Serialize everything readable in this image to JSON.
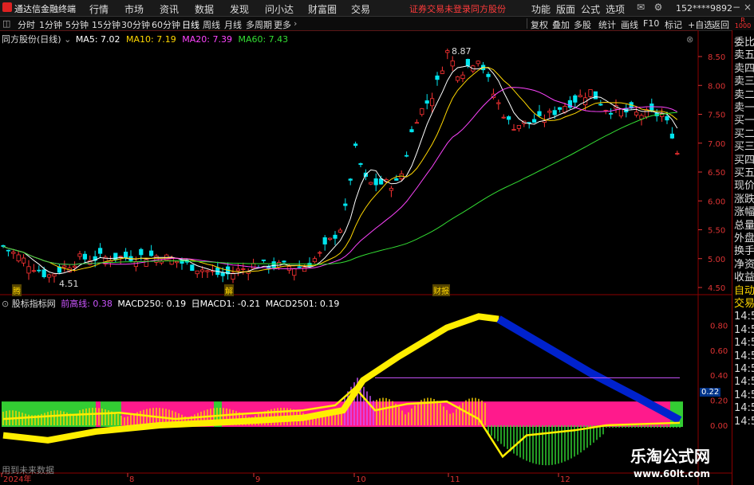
{
  "menu": {
    "app_title": "通达信金融终端",
    "items": [
      "行情",
      "市场",
      "资讯",
      "数据",
      "发现",
      "问小达",
      "财富圈",
      "交易"
    ],
    "login_status": "证券交易未登录",
    "stock_name": "同方股份",
    "right_items": [
      "功能",
      "版面",
      "公式",
      "选项"
    ],
    "account": "152****9892"
  },
  "period_bar": {
    "periods": [
      "分时",
      "1分钟",
      "5分钟",
      "15分钟",
      "30分钟",
      "60分钟",
      "日线",
      "周线",
      "月线",
      "多周期",
      "更多"
    ],
    "active": "日线",
    "tools": [
      "复权",
      "叠加",
      "多股",
      "统计",
      "画线",
      "F10",
      "标记",
      "+自选",
      "返回"
    ]
  },
  "price_panel": {
    "title": "同方股份(日线)",
    "ma": [
      {
        "label": "MA5: 7.02",
        "color": "#ffffff"
      },
      {
        "label": "MA10: 7.19",
        "color": "#ffd700"
      },
      {
        "label": "MA20: 7.39",
        "color": "#ff44ff"
      },
      {
        "label": "MA60: 7.43",
        "color": "#33dd33"
      }
    ],
    "high_label": "8.87",
    "low_label": "4.51",
    "y_ticks": [
      "8.50",
      "8.00",
      "7.50",
      "7.00",
      "6.50",
      "6.00",
      "5.50",
      "5.00",
      "4.50"
    ],
    "markers": [
      {
        "text": "腾"
      },
      {
        "text": "解"
      },
      {
        "text": "财报"
      }
    ]
  },
  "indicator_panel": {
    "title": "股标指标网",
    "values": [
      {
        "label": "前高线: 0.38",
        "color": "#cc55ff"
      },
      {
        "label": "MACD250: 0.19",
        "color": "#ffffff"
      },
      {
        "label": "日MACD1: -0.21",
        "color": "#ffffff"
      },
      {
        "label": "MACD2501: 0.19",
        "color": "#ffffff"
      }
    ],
    "y_ticks": [
      "0.80",
      "0.60",
      "0.40",
      "0.20",
      "0.00"
    ],
    "current_value": "0.22",
    "future_note": "用到未来数据"
  },
  "x_axis": [
    "2024年",
    "8",
    "9",
    "10",
    "11",
    "12"
  ],
  "right_panel": {
    "top_icon": "R\n1000",
    "rows": [
      "委比",
      "卖五",
      "卖四",
      "卖三",
      "卖二",
      "卖一",
      "买一",
      "买二",
      "买三",
      "买四",
      "买五",
      "现价",
      "涨跌",
      "涨幅",
      "总量",
      "外盘",
      "换手",
      "净资",
      "收益",
      "自动",
      "交易",
      "14:5",
      "14:5",
      "14:5",
      "14:5",
      "14:5",
      "14:5",
      "14:5",
      "14:5",
      "14:5"
    ]
  },
  "watermark": {
    "line1": "乐淘公式网",
    "line2": "www.60lt.com"
  }
}
